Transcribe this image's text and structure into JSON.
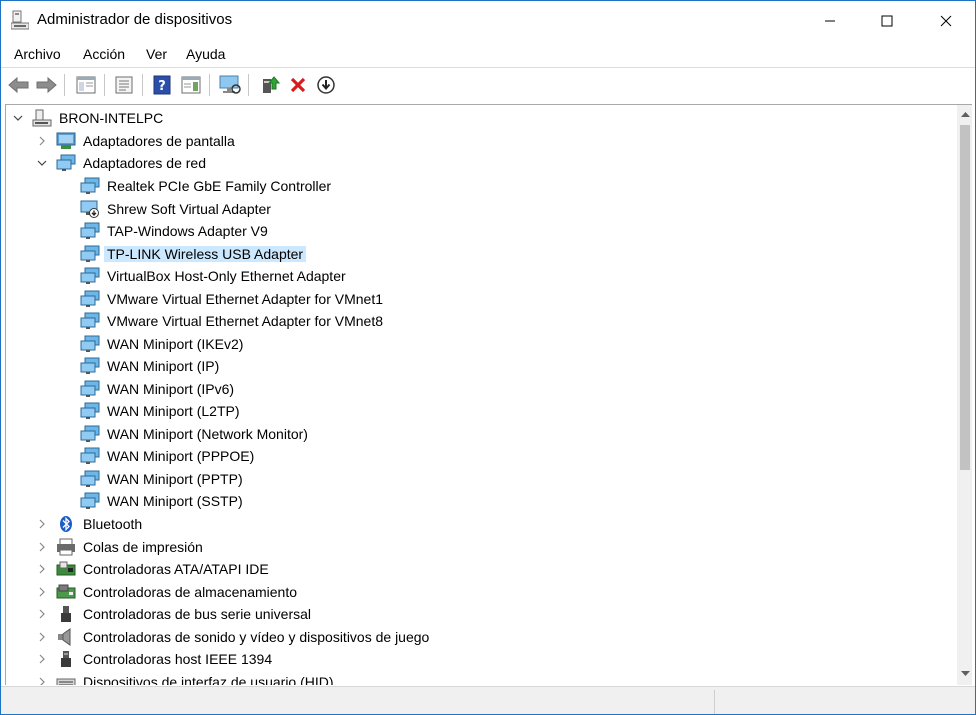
{
  "window": {
    "title": "Administrador de dispositivos",
    "accent": "#1d72c4"
  },
  "menu": [
    "Archivo",
    "Acción",
    "Ver",
    "Ayuda"
  ],
  "toolbar": {
    "icons": [
      "back-arrow-icon",
      "forward-arrow-icon",
      "show-hide-console-tree-icon",
      "properties-icon",
      "help-icon",
      "action-pane-icon",
      "scan-hardware-icon",
      "update-driver-icon",
      "uninstall-icon",
      "disable-device-icon"
    ]
  },
  "tree": {
    "root": "BRON-INTELPC",
    "display_adapters": "Adaptadores de pantalla",
    "network_adapters": "Adaptadores de red",
    "devices": [
      "Realtek PCIe GbE Family Controller",
      "Shrew Soft Virtual Adapter",
      "TAP-Windows Adapter V9",
      "TP-LINK Wireless USB Adapter",
      "VirtualBox Host-Only Ethernet Adapter",
      "VMware Virtual Ethernet Adapter for VMnet1",
      "VMware Virtual Ethernet Adapter for VMnet8",
      "WAN Miniport (IKEv2)",
      "WAN Miniport (IP)",
      "WAN Miniport (IPv6)",
      "WAN Miniport (L2TP)",
      "WAN Miniport (Network Monitor)",
      "WAN Miniport (PPPOE)",
      "WAN Miniport (PPTP)",
      "WAN Miniport (SSTP)"
    ],
    "selected": "TP-LINK Wireless USB Adapter",
    "categories": [
      "Bluetooth",
      "Colas de impresión",
      "Controladoras ATA/ATAPI IDE",
      "Controladoras de almacenamiento",
      "Controladoras de bus serie universal",
      "Controladoras de sonido y vídeo y dispositivos de juego",
      "Controladoras host IEEE 1394",
      "Dispositivos de interfaz de usuario (HID)"
    ],
    "selection_color": "#cce8ff"
  }
}
